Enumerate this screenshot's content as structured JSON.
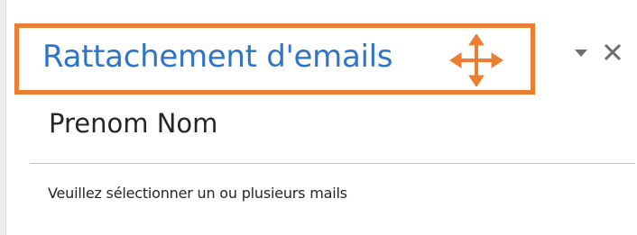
{
  "pane": {
    "title": "Rattachement d'emails",
    "user_name": "Prenom Nom",
    "instruction": "Veuillez sélectionner un ou plusieurs mails"
  },
  "icons": {
    "move": "move-icon",
    "dropdown": "chevron-down-icon",
    "close": "close-icon"
  },
  "colors": {
    "title": "#2e74c9",
    "highlight": "#ed7d31",
    "text": "#262626",
    "divider": "#bdbdbd"
  }
}
